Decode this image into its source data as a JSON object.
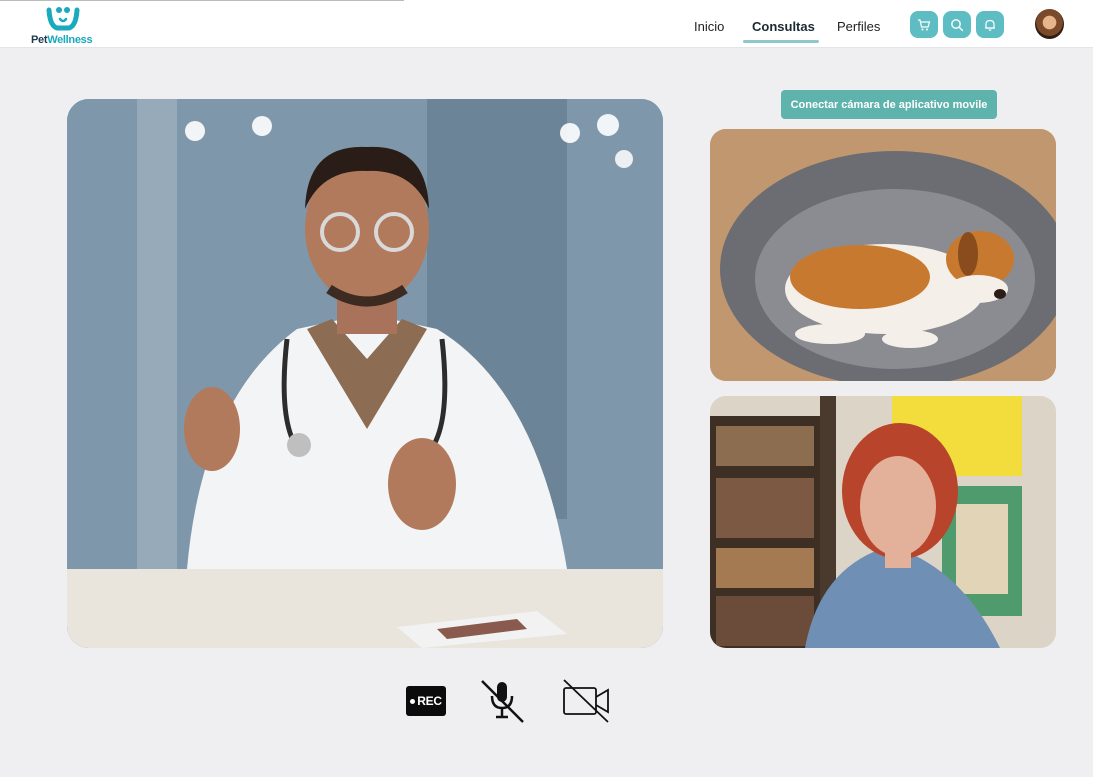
{
  "brand": {
    "name_part1": "Pet",
    "name_part2": "Wellness"
  },
  "nav": {
    "items": [
      {
        "label": "Inicio",
        "active": false
      },
      {
        "label": "Consultas",
        "active": true
      },
      {
        "label": "Perfiles",
        "active": false
      }
    ]
  },
  "toolbar_icons": [
    "cart-icon",
    "search-icon",
    "bell-icon"
  ],
  "colors": {
    "accent": "#5ebdc2",
    "brand_dark": "#1c3a4e",
    "brand_light": "#1aa9bd",
    "button": "#5fb3ad"
  },
  "call": {
    "connect_button_label": "Conectar cámara de aplicativo movile",
    "participants": [
      "veterinarian",
      "pet",
      "owner"
    ]
  },
  "controls": {
    "record_label": "REC",
    "mic_state": "muted",
    "camera_state": "off"
  }
}
